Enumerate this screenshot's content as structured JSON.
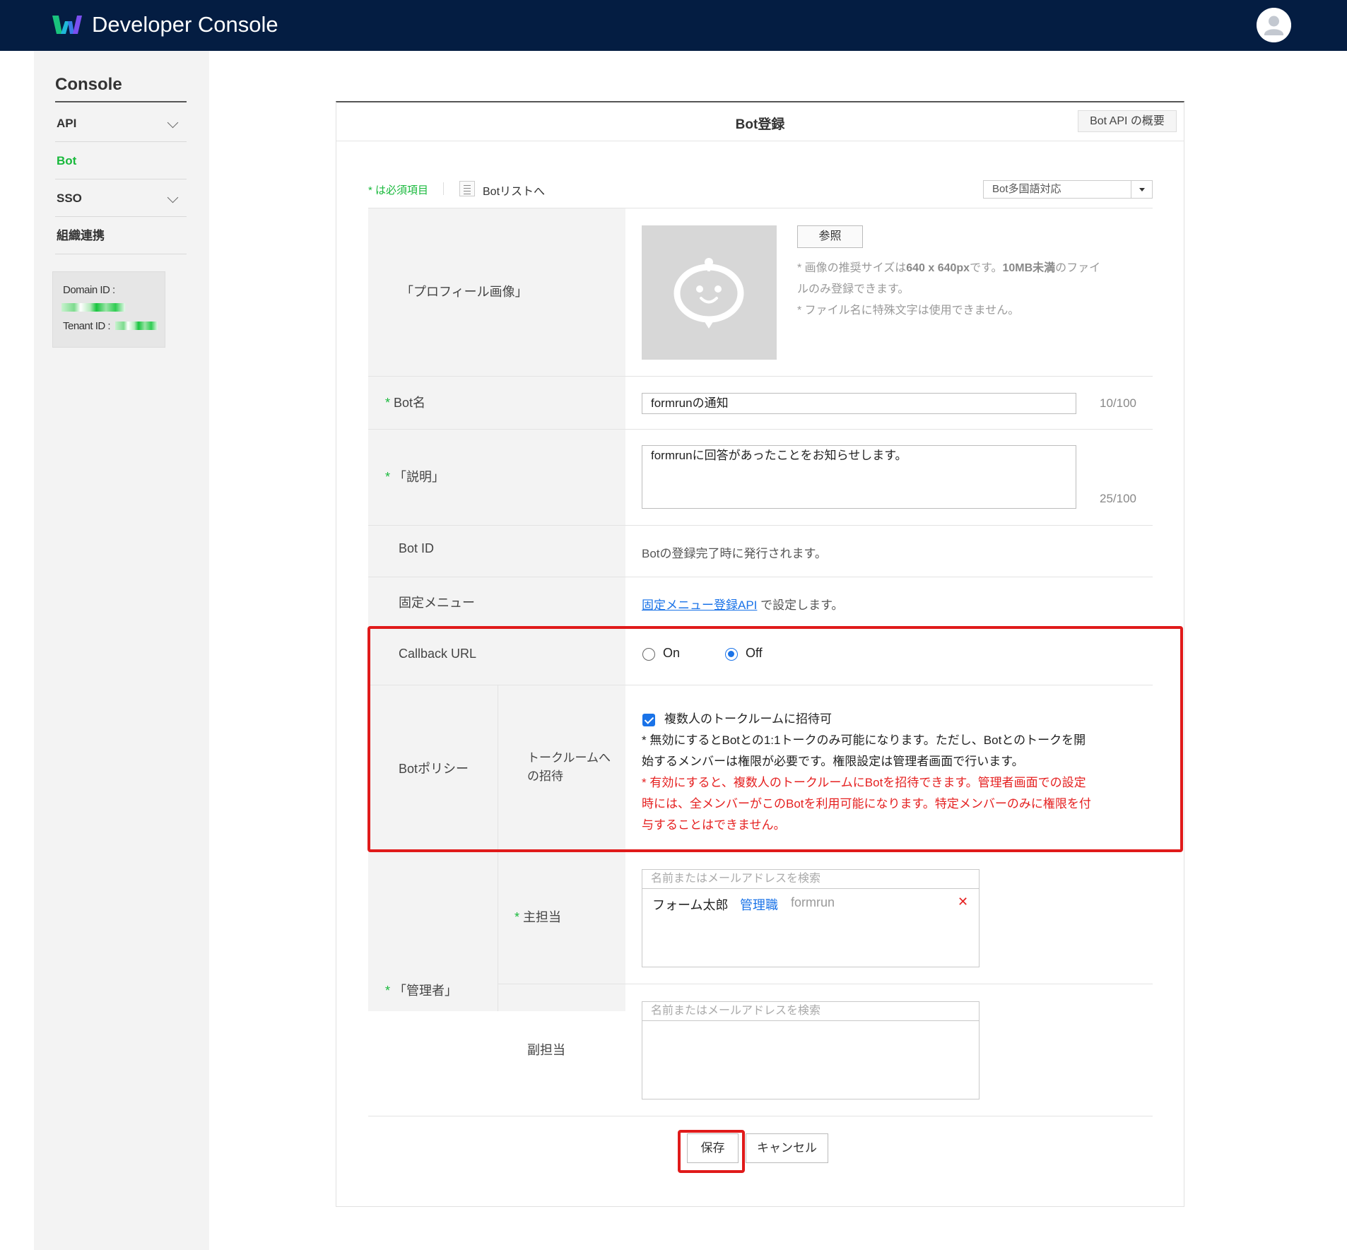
{
  "header": {
    "app_title": "Developer Console",
    "logo_icon": "works-logo-icon",
    "avatar_icon": "user-avatar-icon"
  },
  "sidebar": {
    "title": "Console",
    "items": [
      {
        "label": "API",
        "expandable": true,
        "active": false
      },
      {
        "label": "Bot",
        "expandable": false,
        "active": true
      },
      {
        "label": "SSO",
        "expandable": true,
        "active": false
      },
      {
        "label": "組織連携",
        "expandable": false,
        "active": false
      }
    ],
    "domain_id_label": "Domain ID :",
    "tenant_id_label": "Tenant ID :"
  },
  "card": {
    "title": "Bot登録",
    "api_overview_button": "Bot API の概要",
    "required_note": "* は必須項目",
    "bot_list_link": "Botリストへ",
    "language_select": "Bot多国語対応"
  },
  "form": {
    "profile_image": {
      "label": "「プロフィール画像」",
      "browse_button": "参照",
      "hint_line1_a": "* 画像の推奨サイズは",
      "hint_line1_b": "640 x 640px",
      "hint_line1_c": "です。",
      "hint_line1_d": "10MB未満",
      "hint_line1_e": "のファイ",
      "hint_line2": "ルのみ登録できます。",
      "hint_line3": "* ファイル名に特殊文字は使用できません。"
    },
    "bot_name": {
      "label": "Bot名",
      "value": "formrunの通知",
      "counter": "10/100"
    },
    "description": {
      "label": "「説明」",
      "value": "formrunに回答があったことをお知らせします。",
      "counter": "25/100"
    },
    "bot_id": {
      "label": "Bot ID",
      "text": "Botの登録完了時に発行されます。"
    },
    "fixed_menu": {
      "label": "固定メニュー",
      "link_text": "固定メニュー登録API",
      "suffix": " で設定します。"
    },
    "callback_url": {
      "label": "Callback URL",
      "option_on": "On",
      "option_off": "Off",
      "selected": "Off"
    },
    "bot_policy": {
      "label": "Botポリシー",
      "sub_label_line1": "トークルームへ",
      "sub_label_line2": "の招待",
      "checkbox_label": "複数人のトークルームに招待可",
      "checked": true,
      "note_line1": "* 無効にするとBotとの1:1トークのみ可能になります。ただし、Botとのトークを開",
      "note_line2": "始するメンバーは権限が必要です。権限設定は管理者画面で行います。",
      "warn_line1": "* 有効にすると、複数人のトークルームにBotを招待できます。管理者画面での設定",
      "warn_line2": "時には、全メンバーがこのBotを利用可能になります。特定メンバーのみに権限を付",
      "warn_line3": "与することはできません。"
    },
    "admins": {
      "label": "「管理者」",
      "primary_label": "主担当",
      "primary_placeholder": "名前またはメールアドレスを検索",
      "primary_user": {
        "name": "フォーム太郎",
        "role": "管理職",
        "org": "formrun"
      },
      "secondary_label": "副担当",
      "secondary_placeholder": "名前またはメールアドレスを検索"
    }
  },
  "actions": {
    "save": "保存",
    "cancel": "キャンセル"
  },
  "colors": {
    "header_bg": "#041d42",
    "accent_green": "#19b93c",
    "link_blue": "#1a73e8",
    "highlight_red": "#e01a1a"
  }
}
